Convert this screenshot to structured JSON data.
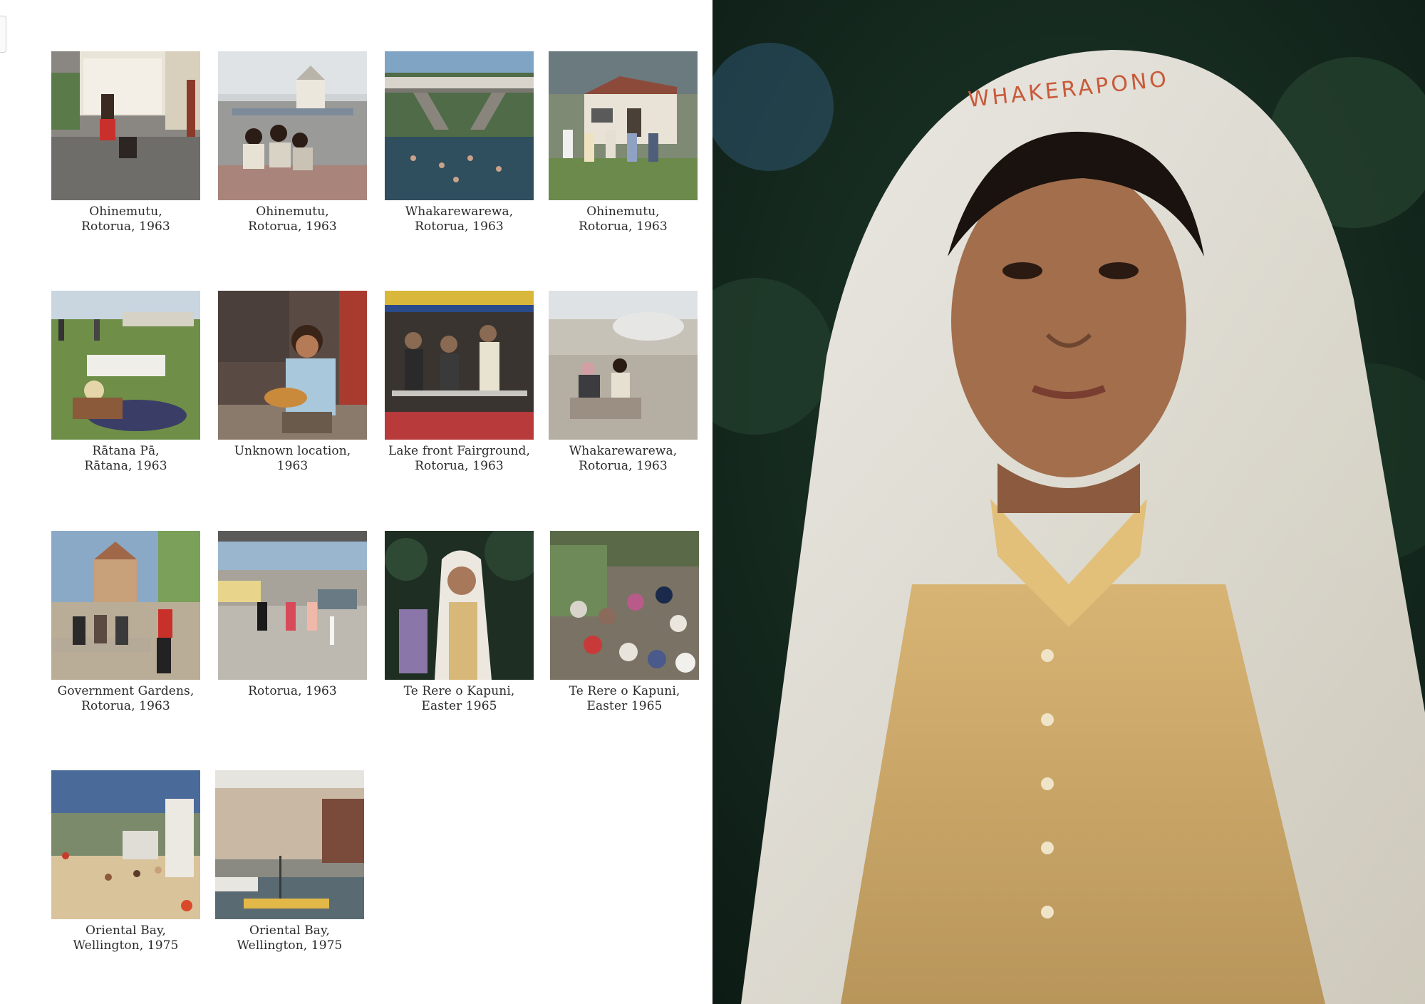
{
  "thumbnails": [
    {
      "caption": "Ohinemutu,\nRotorua, 1963"
    },
    {
      "caption": "Ohinemutu,\nRotorua, 1963"
    },
    {
      "caption": "Whakarewarewa,\nRotorua, 1963"
    },
    {
      "caption": "Ohinemutu,\nRotorua, 1963"
    },
    {
      "caption": "Rātana Pā,\nRātana, 1963"
    },
    {
      "caption": "Unknown location, 1963"
    },
    {
      "caption": "Lake front Fairground,\nRotorua, 1963"
    },
    {
      "caption": "Whakarewarewa,\nRotorua, 1963"
    },
    {
      "caption": "Government Gardens,\nRotorua, 1963"
    },
    {
      "caption": "Rotorua, 1963"
    },
    {
      "caption": "Te Rere o Kapuni,\nEaster 1965"
    },
    {
      "caption": "Te Rere o Kapuni,\nEaster 1965"
    },
    {
      "caption": "Oriental Bay,\nWellington, 1975"
    },
    {
      "caption": "Oriental Bay,\nWellington, 1975"
    }
  ],
  "feature_photo": {
    "scarf_embroidery": "WHAKERAPONO"
  }
}
